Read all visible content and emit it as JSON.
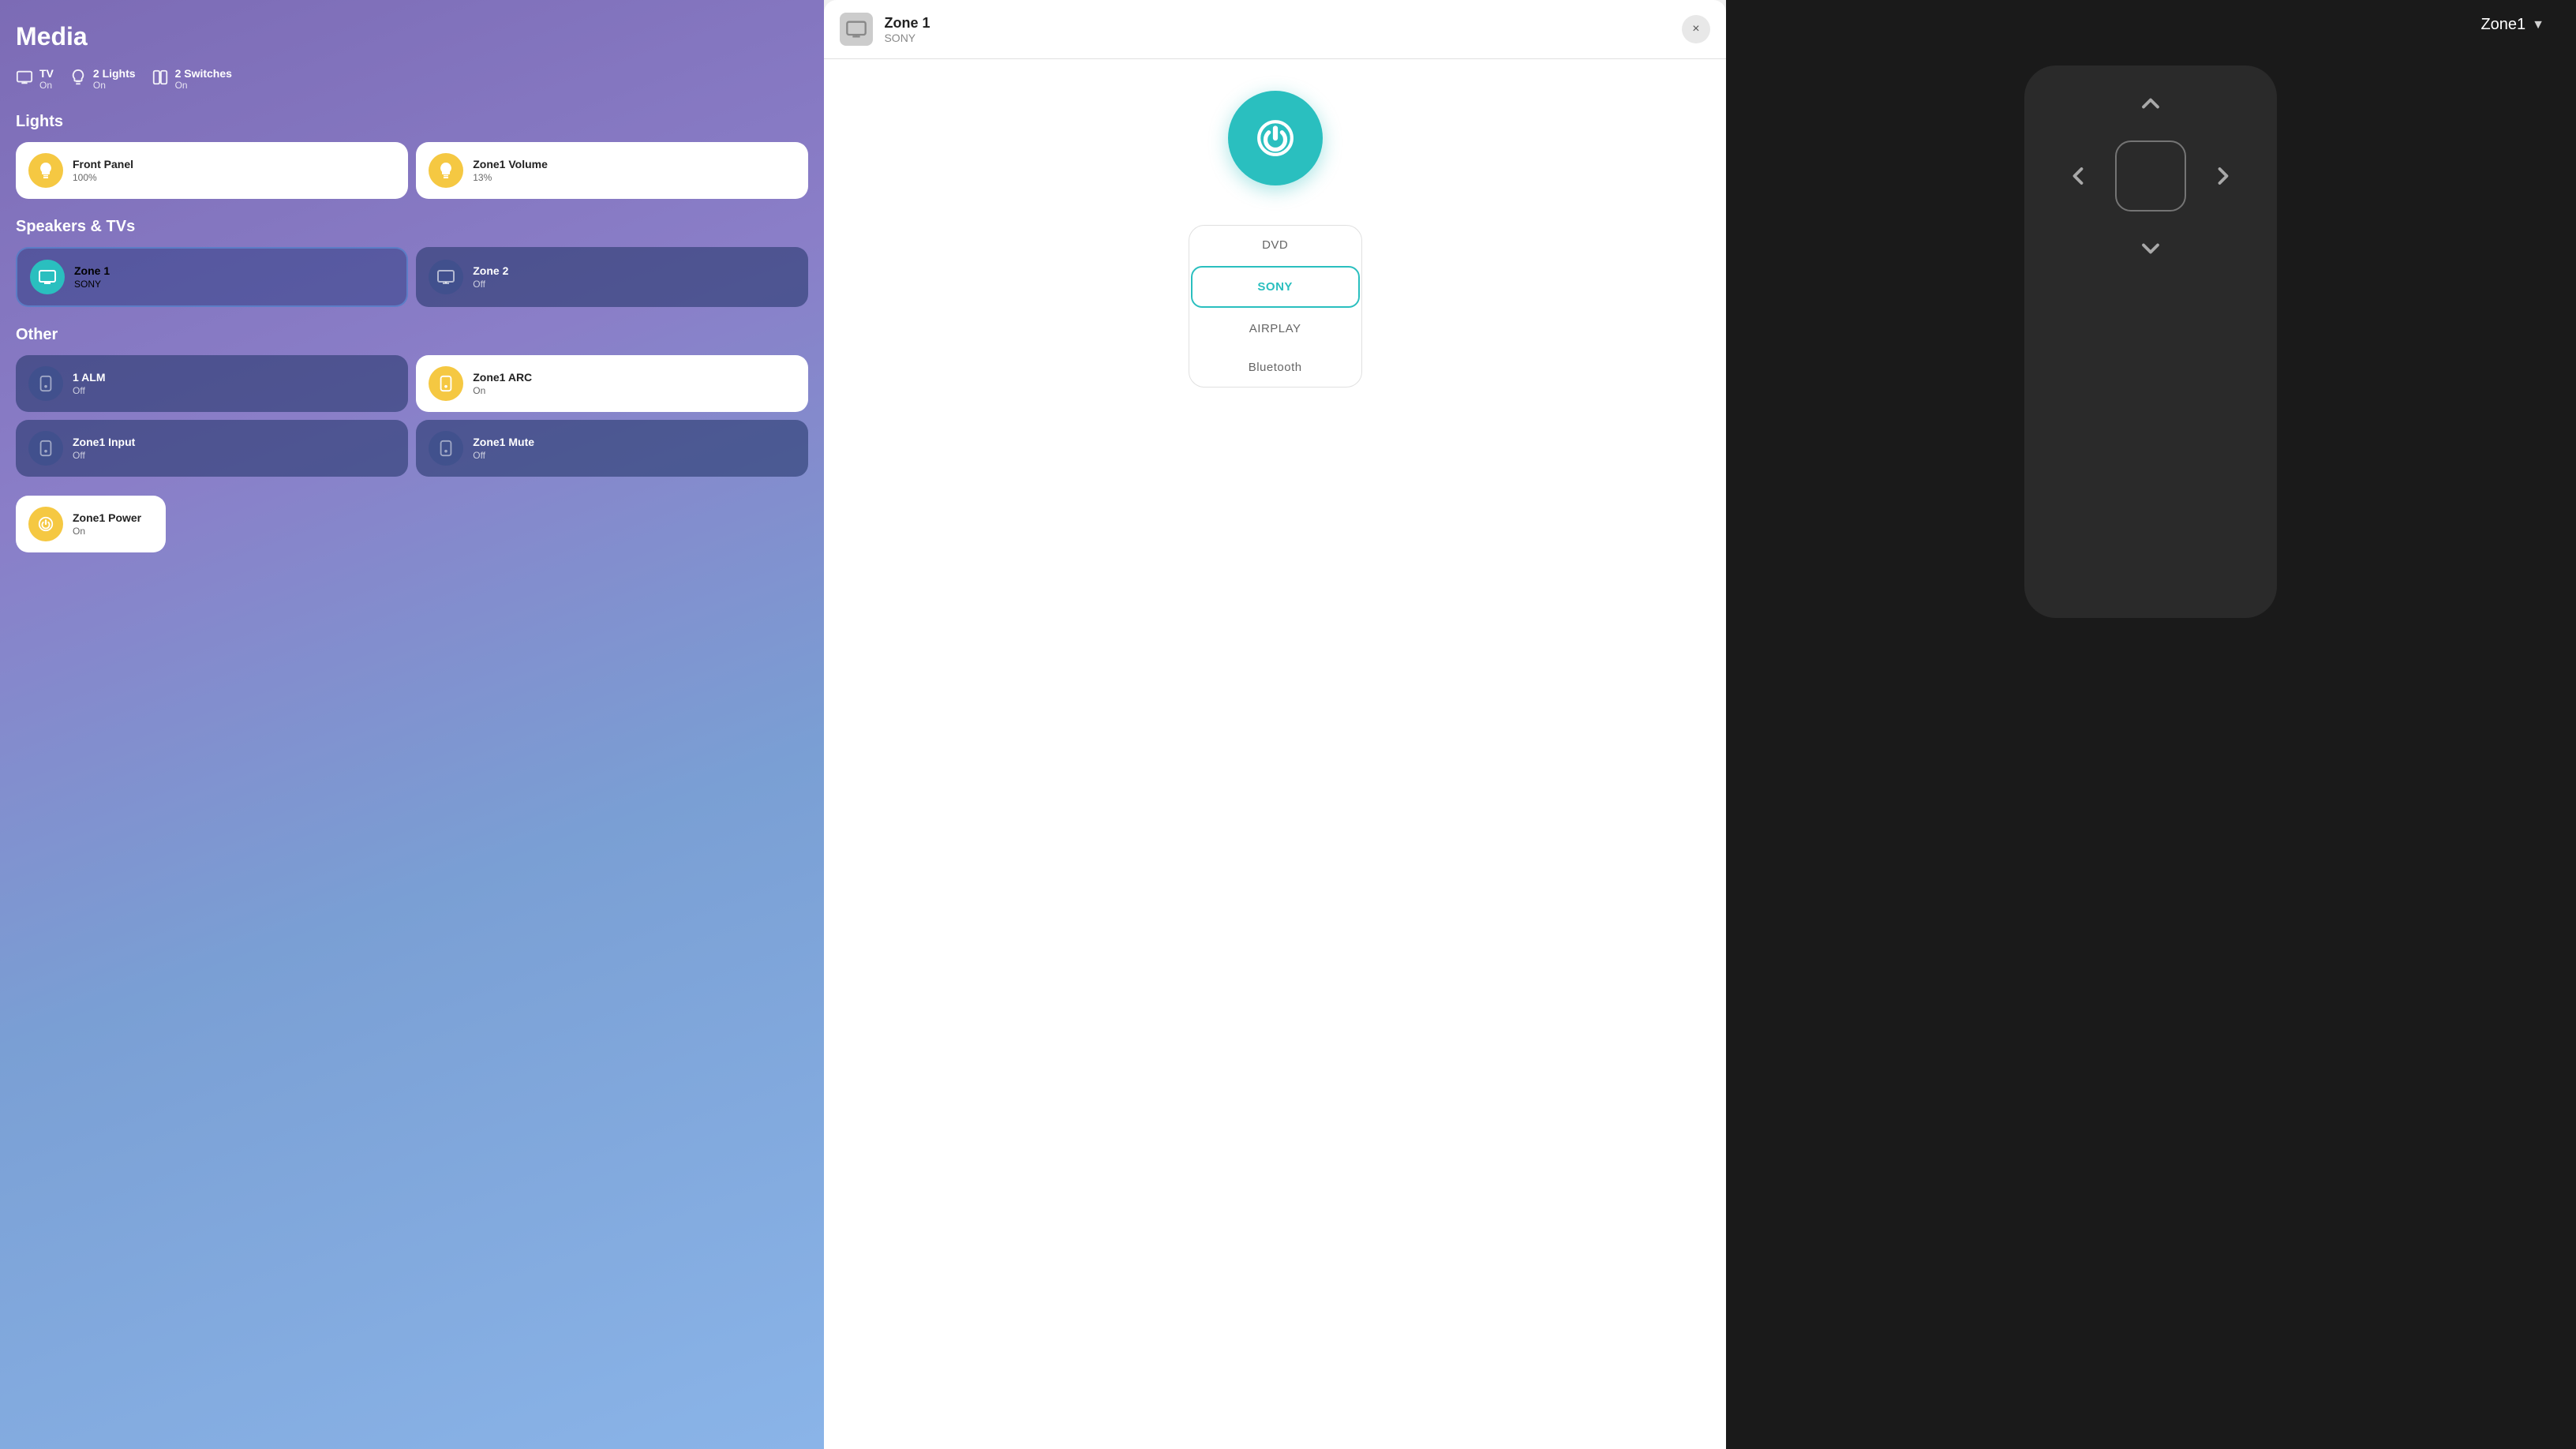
{
  "leftPanel": {
    "title": "Media",
    "statusRow": [
      {
        "id": "tv",
        "iconType": "tv",
        "label": "TV",
        "value": "On"
      },
      {
        "id": "lights",
        "iconType": "light",
        "label": "2 Lights",
        "value": "On"
      },
      {
        "id": "switches",
        "iconType": "switch",
        "label": "2 Switches",
        "value": "On"
      }
    ],
    "sections": [
      {
        "id": "lights",
        "title": "Lights",
        "cards": [
          {
            "id": "front-panel",
            "name": "Front Panel",
            "value": "100%",
            "style": "light",
            "iconColor": "yellow",
            "iconType": "bulb"
          },
          {
            "id": "zone1-volume",
            "name": "Zone1 Volume",
            "value": "13%",
            "style": "light",
            "iconColor": "yellow",
            "iconType": "bulb"
          }
        ]
      },
      {
        "id": "speakers-tvs",
        "title": "Speakers & TVs",
        "cards": [
          {
            "id": "zone1",
            "name": "Zone 1",
            "value": "SONY",
            "style": "active",
            "iconColor": "teal",
            "iconType": "tv"
          },
          {
            "id": "zone2",
            "name": "Zone 2",
            "value": "Off",
            "style": "dark",
            "iconColor": "dark",
            "iconType": "tv"
          }
        ]
      },
      {
        "id": "other",
        "title": "Other",
        "cards": [
          {
            "id": "1alm",
            "name": "1 ALM",
            "value": "Off",
            "style": "dark",
            "iconColor": "dark",
            "iconType": "switch"
          },
          {
            "id": "zone1-arc",
            "name": "Zone1 ARC",
            "value": "On",
            "style": "light",
            "iconColor": "yellow",
            "iconType": "switch"
          },
          {
            "id": "zone1-input",
            "name": "Zone1 Input",
            "value": "Off",
            "style": "dark",
            "iconColor": "dark",
            "iconType": "switch"
          },
          {
            "id": "zone1-mute",
            "name": "Zone1 Mute",
            "value": "Off",
            "style": "dark",
            "iconColor": "dark",
            "iconType": "switch"
          },
          {
            "id": "zone1-power",
            "name": "Zone1 Power",
            "value": "On",
            "style": "light",
            "iconColor": "yellow",
            "iconType": "switch"
          }
        ]
      }
    ]
  },
  "centerPanel": {
    "title": "Zone 1",
    "subtitle": "SONY",
    "closeLabel": "×",
    "powerButtonLabel": "Power",
    "sources": [
      {
        "id": "dvd",
        "label": "DVD",
        "active": false
      },
      {
        "id": "sony",
        "label": "SONY",
        "active": true
      },
      {
        "id": "airplay",
        "label": "AIRPLAY",
        "active": false
      },
      {
        "id": "bluetooth",
        "label": "Bluetooth",
        "active": false
      }
    ]
  },
  "rightPanel": {
    "zoneLabel": "Zone1",
    "dpad": {
      "up": "⌃",
      "down": "⌄",
      "left": "‹",
      "right": "›"
    }
  }
}
